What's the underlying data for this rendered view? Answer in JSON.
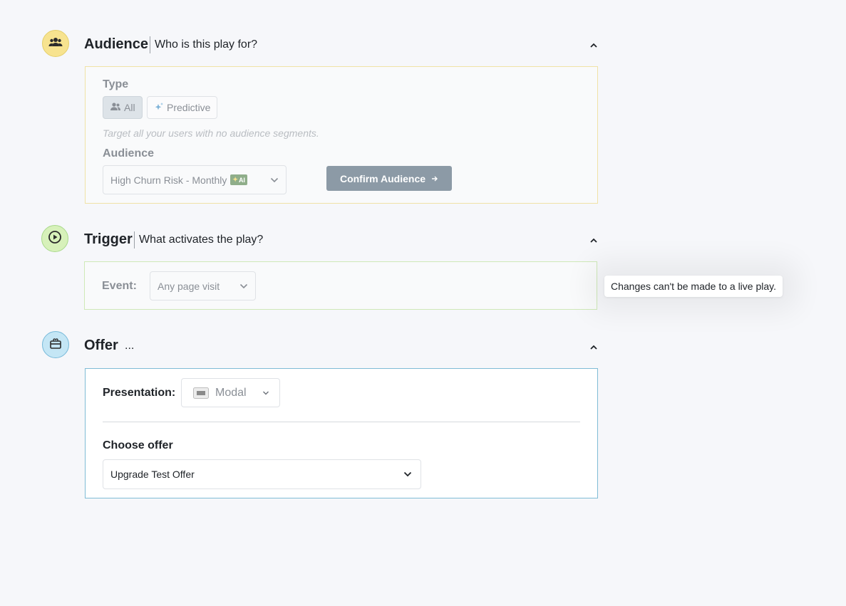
{
  "audience": {
    "title": "Audience",
    "subtitle": "Who is this play for?",
    "type_label": "Type",
    "type_options": [
      {
        "label": "All",
        "icon": "users-icon",
        "selected": true
      },
      {
        "label": "Predictive",
        "icon": "sparkle-icon",
        "selected": false
      }
    ],
    "hint": "Target all your users with no audience segments.",
    "audience_label": "Audience",
    "audience_value": "High Churn Risk - Monthly",
    "ai_badge": "AI",
    "confirm_label": "Confirm Audience",
    "icon": "people-group-icon",
    "accent": "#f5e28c"
  },
  "trigger": {
    "title": "Trigger",
    "subtitle": "What activates the play?",
    "event_label": "Event:",
    "event_value": "Any page visit",
    "icon": "play-circle-icon",
    "accent": "#d6f0b8"
  },
  "tooltip": {
    "text": "Changes can't be made to a live play."
  },
  "offer": {
    "title": "Offer",
    "subtitle": "...",
    "presentation_label": "Presentation:",
    "presentation_value": "Modal",
    "choose_label": "Choose offer",
    "offer_value": "Upgrade Test Offer",
    "icon": "gift-box-icon",
    "accent": "#bfe3f2"
  }
}
